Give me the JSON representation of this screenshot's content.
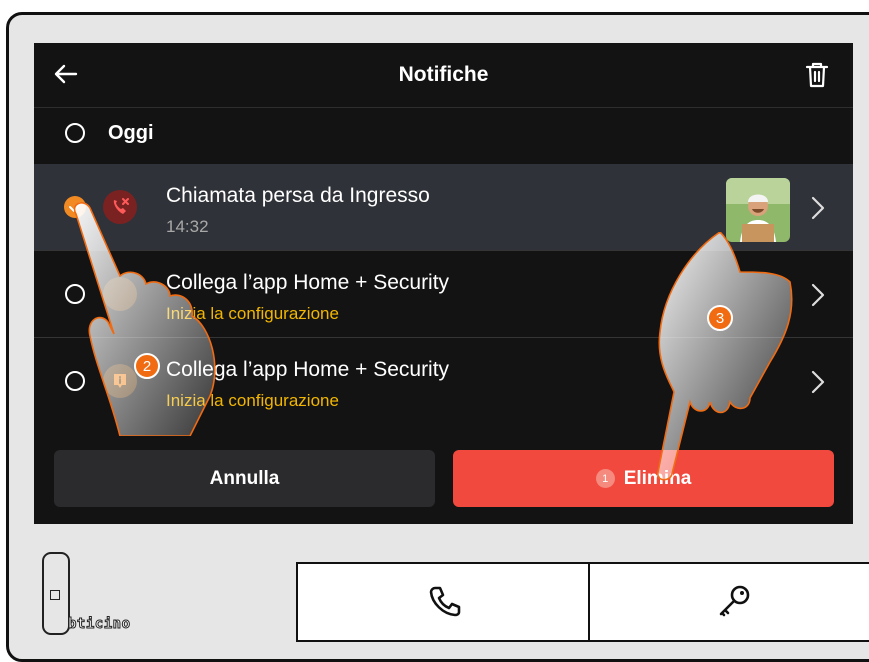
{
  "header": {
    "title": "Notifiche",
    "back_icon": "arrow-left-icon",
    "delete_icon": "trash-icon"
  },
  "section": {
    "label": "Oggi"
  },
  "notifications": [
    {
      "title": "Chiamata persa da Ingresso",
      "subtitle": "14:32",
      "subtitle_color": "#a8a8a8",
      "icon": "missed-call-icon",
      "icon_color": "#d83a3a",
      "selected": true,
      "has_thumbnail": true
    },
    {
      "title": "Collega l’app Home + Security",
      "subtitle": "Inizia la configurazione",
      "subtitle_color": "#f2b600",
      "icon": "info-badge-icon",
      "icon_color": "#f28a23",
      "selected": false,
      "has_thumbnail": false
    },
    {
      "title": "Collega l’app Home + Security",
      "subtitle": "Inizia la configurazione",
      "subtitle_color": "#f2b600",
      "icon": "info-badge-icon",
      "icon_color": "#f28a23",
      "selected": false,
      "has_thumbnail": false
    }
  ],
  "footer": {
    "cancel_label": "Annulla",
    "delete_label": "Elimina",
    "delete_count": "1"
  },
  "annotations": {
    "step2": "2",
    "step3": "3"
  },
  "brand": {
    "logo": "bticino"
  },
  "colors": {
    "accent": "#f2493f",
    "selection": "#f28a23",
    "screen_bg": "#131313"
  }
}
